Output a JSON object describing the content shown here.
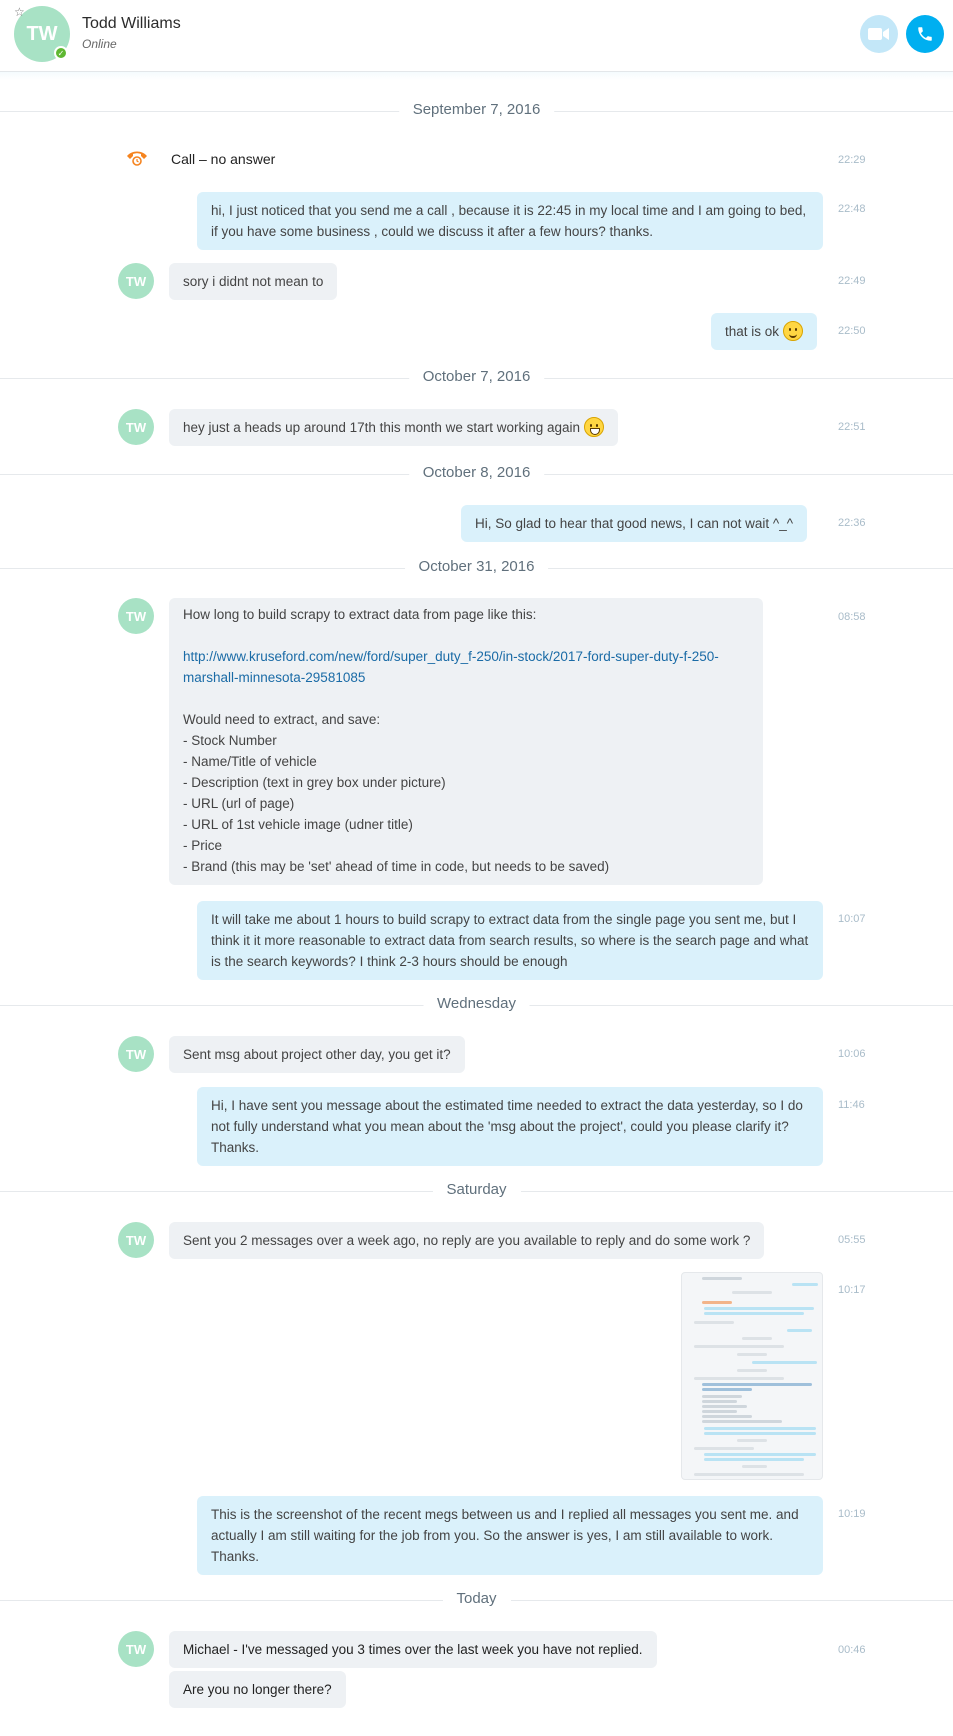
{
  "header": {
    "avatar_initials": "TW",
    "contact_name": "Todd Williams",
    "status": "Online",
    "video_call_icon": "video-camera-icon",
    "audio_call_icon": "phone-icon"
  },
  "colors": {
    "accent": "#00aff0",
    "incoming_bubble": "#eef1f4",
    "outgoing_bubble": "#daf1fb",
    "avatar": "#a8e2c5",
    "online": "#5fb832",
    "missed_call": "#f5841f"
  },
  "conversation": {
    "separators": {
      "s1": "September 7, 2016",
      "s2": "October 7, 2016",
      "s3": "October 8, 2016",
      "s4": "October 31, 2016",
      "s5": "Wednesday",
      "s6": "Saturday",
      "s7": "Today"
    },
    "sender_initials": "TW",
    "call_event": {
      "text": "Call – no answer",
      "time": "22:29"
    },
    "m1": {
      "text": "hi, I just noticed that you send me a call , because it is 22:45 in my local time and I am going to bed, if you have some business , could we discuss it after a few hours? thanks.",
      "time": "22:48"
    },
    "m2": {
      "text": "sory i didnt not mean to",
      "time": "22:49"
    },
    "m3": {
      "text": "that is ok",
      "time": "22:50"
    },
    "m4": {
      "text": "hey just a heads up around 17th this month we start working again",
      "time": "22:51"
    },
    "m5": {
      "text": "Hi, So glad to hear that good news, I can not wait ^_^",
      "time": "22:36"
    },
    "m6": {
      "intro": "How long to build scrapy to extract data from page like this:",
      "link": "http://www.kruseford.com/new/ford/super_duty_f-250/in-stock/2017-ford-super-duty-f-250-marshall-minnesota-29581085",
      "list_intro": "Would need to extract, and save:",
      "items": [
        "- Stock Number",
        "- Name/Title of vehicle",
        "- Description (text in grey box under picture)",
        "- URL (url of page)",
        "- URL of 1st vehicle image (udner title)",
        "- Price",
        "- Brand (this may be 'set' ahead of time in code, but needs to be saved)"
      ],
      "time": "08:58"
    },
    "m7": {
      "text": "It will take me about 1 hours to build scrapy to extract data from the single page you sent me, but I think it it more reasonable to extract data from search results, so where is the search page and what is the search keywords? I think 2-3 hours should be enough",
      "time": "10:07"
    },
    "m8": {
      "text": "Sent msg about project other day, you get it?",
      "time": "10:06"
    },
    "m9": {
      "text": "Hi, I have sent you message about the estimated time needed to extract the data yesterday, so I do not fully understand what you mean about the 'msg about the project', could you please clarify it? Thanks.",
      "time": "11:46"
    },
    "m10": {
      "text": "Sent you 2 messages over a week ago, no reply are you available to reply and do some work ?",
      "time": "05:55"
    },
    "m11": {
      "time": "10:17"
    },
    "m12": {
      "text": "This is the screenshot of the recent megs between us and I replied all messages you sent me. and actually I am still waiting for the job from you. So the answer is yes, I am still available to work. Thanks.",
      "time": "10:19"
    },
    "m13": {
      "text": "Michael - I've messaged you 3 times over the last week you have not replied.",
      "time": "00:46"
    },
    "m14": {
      "text": "Are you no longer there?"
    }
  }
}
